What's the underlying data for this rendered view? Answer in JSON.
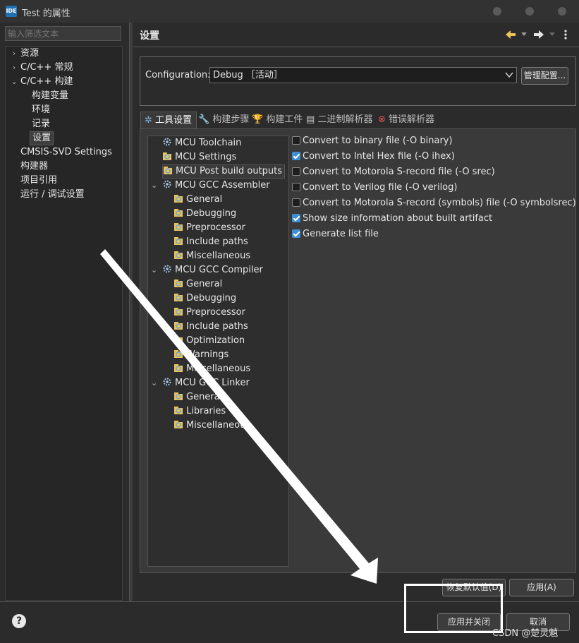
{
  "window": {
    "app_icon": "IDE",
    "title": "Test 的属性"
  },
  "sidebar": {
    "filter_placeholder": "输入筛选文本",
    "items": [
      {
        "label": "资源",
        "expander": "›"
      },
      {
        "label": "C/C++ 常规",
        "expander": "›"
      },
      {
        "label": "C/C++ 构建",
        "expander": "⌄"
      },
      {
        "label": "构建变量"
      },
      {
        "label": "环境"
      },
      {
        "label": "记录"
      },
      {
        "label": "设置"
      },
      {
        "label": "CMSIS-SVD Settings"
      },
      {
        "label": "构建器"
      },
      {
        "label": "项目引用"
      },
      {
        "label": "运行 / 调试设置"
      }
    ]
  },
  "header": {
    "title": "设置",
    "back_icon": "back-arrow-icon",
    "forward_icon": "forward-arrow-icon",
    "menu_icon": "more-vertical-icon"
  },
  "configuration": {
    "label": "Configuration:",
    "value": "Debug ［活动］",
    "manage_button": "管理配置..."
  },
  "tabs": [
    {
      "label": "工具设置",
      "icon": "gear-icon",
      "active": true
    },
    {
      "label": "构建步骤",
      "icon": "wrench-icon"
    },
    {
      "label": "构建工件",
      "icon": "trophy-icon"
    },
    {
      "label": "二进制解析器",
      "icon": "binary-file-icon"
    },
    {
      "label": "错误解析器",
      "icon": "error-icon"
    }
  ],
  "tree": [
    {
      "label": "MCU Toolchain",
      "icon": "gear-icon"
    },
    {
      "label": "MCU Settings",
      "icon": "gear-folder-icon"
    },
    {
      "label": "MCU Post build outputs",
      "icon": "gear-folder-icon"
    },
    {
      "label": "MCU GCC Assembler",
      "icon": "gear-icon",
      "expander": "⌄"
    },
    {
      "label": "General",
      "icon": "gear-folder-icon"
    },
    {
      "label": "Debugging",
      "icon": "gear-folder-icon"
    },
    {
      "label": "Preprocessor",
      "icon": "gear-folder-icon"
    },
    {
      "label": "Include paths",
      "icon": "gear-folder-icon"
    },
    {
      "label": "Miscellaneous",
      "icon": "gear-folder-icon"
    },
    {
      "label": "MCU GCC Compiler",
      "icon": "gear-icon",
      "expander": "⌄"
    },
    {
      "label": "General",
      "icon": "gear-folder-icon"
    },
    {
      "label": "Debugging",
      "icon": "gear-folder-icon"
    },
    {
      "label": "Preprocessor",
      "icon": "gear-folder-icon"
    },
    {
      "label": "Include paths",
      "icon": "gear-folder-icon"
    },
    {
      "label": "Optimization",
      "icon": "gear-folder-icon"
    },
    {
      "label": "Warnings",
      "icon": "gear-folder-icon"
    },
    {
      "label": "Miscellaneous",
      "icon": "gear-folder-icon"
    },
    {
      "label": "MCU GCC Linker",
      "icon": "gear-icon",
      "expander": "⌄"
    },
    {
      "label": "General",
      "icon": "gear-folder-icon"
    },
    {
      "label": "Libraries",
      "icon": "gear-folder-icon"
    },
    {
      "label": "Miscellaneous",
      "icon": "gear-folder-icon"
    }
  ],
  "options": [
    {
      "label": "Convert to binary file (-O binary)",
      "checked": false
    },
    {
      "label": "Convert to Intel Hex file (-O ihex)",
      "checked": true
    },
    {
      "label": "Convert to Motorola S-record file (-O srec)",
      "checked": false
    },
    {
      "label": "Convert to Verilog file (-O verilog)",
      "checked": false
    },
    {
      "label": "Convert to Motorola S-record (symbols) file (-O symbolsrec)",
      "checked": false
    },
    {
      "label": "Show size information about built artifact",
      "checked": true
    },
    {
      "label": "Generate list file",
      "checked": true
    }
  ],
  "buttons": {
    "restore_defaults": "恢复默认值(D)",
    "apply": "应用(A)",
    "apply_and_close": "应用并关闭",
    "cancel": "取消"
  },
  "watermark": "CSDN @楚灵魈",
  "colors": {
    "accent": "#3d8fd6",
    "background": "#2b2b2b",
    "annotation": "#ffffff"
  }
}
